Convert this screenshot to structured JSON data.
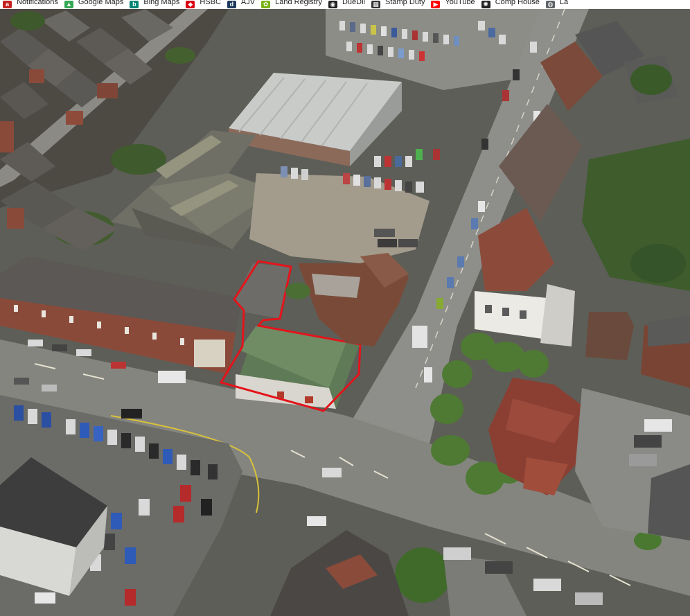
{
  "bookmarks": [
    {
      "label": "Notifications",
      "icon": "notifications-icon",
      "color": "#c5221f",
      "glyph": "a"
    },
    {
      "label": "Google Maps",
      "icon": "google-maps-icon",
      "color": "#34a853",
      "glyph": "▲"
    },
    {
      "label": "Bing Maps",
      "icon": "bing-maps-icon",
      "color": "#008373",
      "glyph": "b"
    },
    {
      "label": "HSBC",
      "icon": "hsbc-icon",
      "color": "#db0011",
      "glyph": "◆"
    },
    {
      "label": "AJV",
      "icon": "ajv-icon",
      "color": "#1e3a5f",
      "glyph": "d"
    },
    {
      "label": "Land Registry",
      "icon": "land-registry-icon",
      "color": "#7ab317",
      "glyph": "✿"
    },
    {
      "label": "DueDil",
      "icon": "duedil-icon",
      "color": "#222222",
      "glyph": "◉"
    },
    {
      "label": "Stamp Duty",
      "icon": "stamp-duty-icon",
      "color": "#333333",
      "glyph": "▦"
    },
    {
      "label": "YouTube",
      "icon": "youtube-icon",
      "color": "#ff0000",
      "glyph": "▶"
    },
    {
      "label": "Comp House",
      "icon": "comp-house-icon",
      "color": "#222222",
      "glyph": "✺"
    },
    {
      "label": "La",
      "icon": "globe-icon",
      "color": "#5f6368",
      "glyph": "◍"
    }
  ],
  "map": {
    "view": "aerial-3d",
    "highlight_color": "#e3141b"
  }
}
